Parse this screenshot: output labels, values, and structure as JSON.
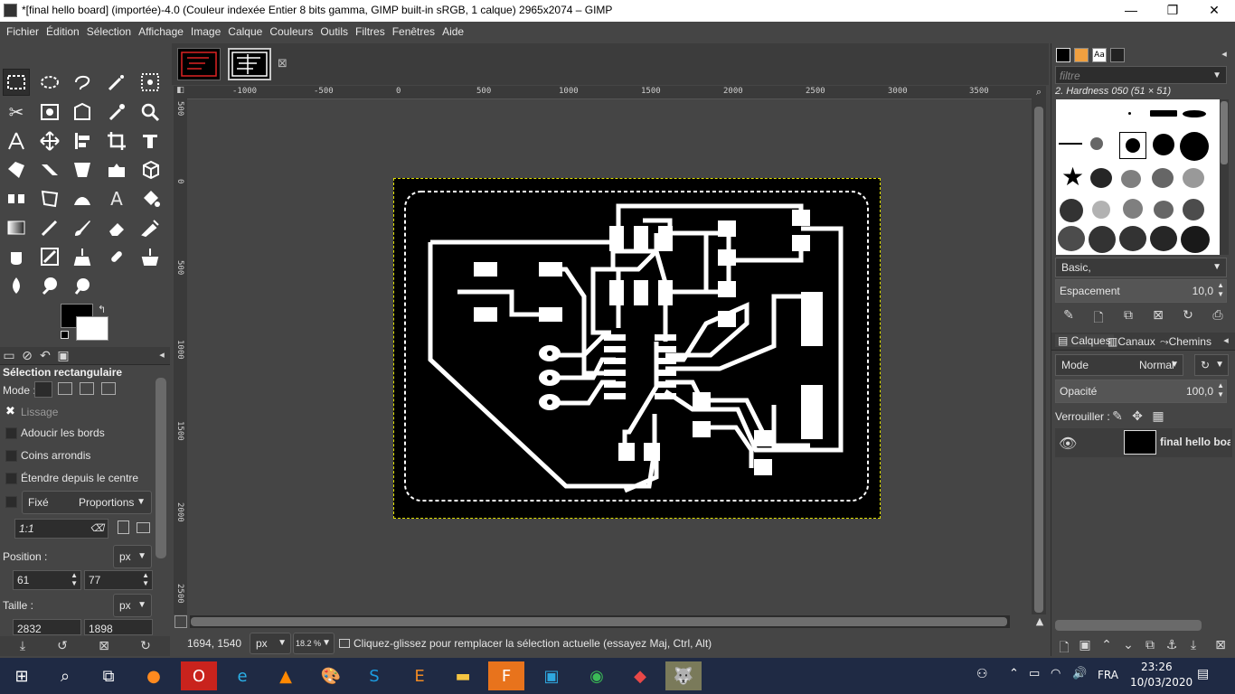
{
  "window": {
    "title": "*[final hello board] (importée)-4.0 (Couleur indexée Entier 8 bits gamma, GIMP built-in sRGB, 1 calque) 2965x2074 – GIMP",
    "minimize": "—",
    "maximize": "❐",
    "close": "✕"
  },
  "menu": [
    "Fichier",
    "Édition",
    "Sélection",
    "Affichage",
    "Image",
    "Calque",
    "Couleurs",
    "Outils",
    "Filtres",
    "Fenêtres",
    "Aide"
  ],
  "tool_options": {
    "title": "Sélection rectangulaire",
    "mode_label": "Mode :",
    "antialias_label": "Lissage",
    "feather_label": "Adoucir les bords",
    "rounded_label": "Coins arrondis",
    "expand_label": "Étendre depuis le centre",
    "fixed_label": "Fixé",
    "fixed_value": "Proportions",
    "ratio_value": "1:1",
    "position_label": "Position :",
    "position_unit": "px",
    "position_x": "61",
    "position_y": "77",
    "size_label": "Taille :",
    "size_unit": "px",
    "size_w": "2832",
    "size_h": "1898"
  },
  "rulers": {
    "h_ticks": [
      "-1000",
      "-500",
      "0",
      "500",
      "1000",
      "1500",
      "2000",
      "2500",
      "3000",
      "3500"
    ],
    "v_ticks": [
      "500",
      "0",
      "500",
      "1000",
      "1500",
      "2000",
      "2500"
    ]
  },
  "status": {
    "coords": "1694, 1540",
    "unit": "px",
    "zoom": "18.2 %",
    "message": "Cliquez-glissez pour remplacer la sélection actuelle (essayez Maj, Ctrl, Alt)"
  },
  "brushes": {
    "filter_placeholder": "filtre",
    "current": "2. Hardness 050 (51 × 51)",
    "tag": "Basic,",
    "spacing_label": "Espacement",
    "spacing_value": "10,0"
  },
  "layers": {
    "tabs": [
      "Calques",
      "Canaux",
      "Chemins"
    ],
    "mode_label": "Mode",
    "mode_value": "Normal",
    "opacity_label": "Opacité",
    "opacity_value": "100,0",
    "lock_label": "Verrouiller :",
    "layer_name": "final hello board"
  },
  "taskbar": {
    "language": "FRA",
    "time": "23:26",
    "date": "10/03/2020"
  }
}
